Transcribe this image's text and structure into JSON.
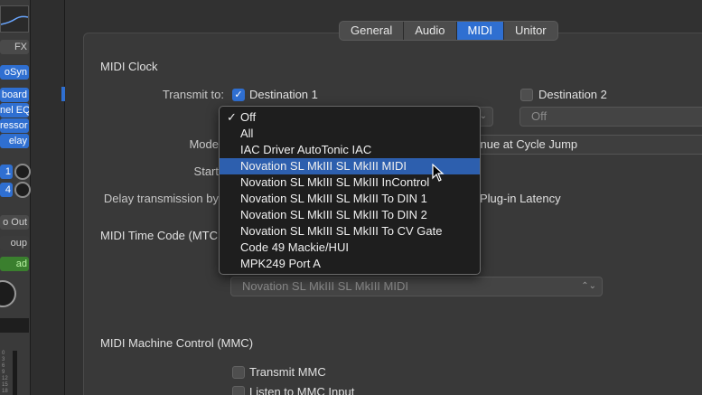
{
  "mixer": {
    "top_label": "FX",
    "plugins": [
      "oSyn",
      "board",
      "nel EQ",
      "ressor",
      "elay"
    ],
    "inputs": [
      "1",
      "4"
    ],
    "output": "o Out",
    "group": "oup",
    "automation": "ad",
    "scale": [
      "0",
      "3",
      "6",
      "9",
      "12",
      "15",
      "18",
      "21"
    ]
  },
  "tabs": [
    {
      "label": "General",
      "active": false
    },
    {
      "label": "Audio",
      "active": false
    },
    {
      "label": "MIDI",
      "active": true
    },
    {
      "label": "Unitor",
      "active": false
    }
  ],
  "midi_clock": {
    "title": "MIDI Clock",
    "transmit_label": "Transmit to:",
    "dest1_label": "Destination 1",
    "dest2_label": "Destination 2",
    "dest2_value": "Off",
    "mode_label": "Mode",
    "mode_value": "tinue at Cycle Jump",
    "start_label": "Start",
    "delay_label": "Delay transmission by",
    "plugin_latency_label": "Plug-in Latency"
  },
  "mtc": {
    "title": "MIDI Time Code (MTC",
    "destination_value": "Novation SL MkIII SL MkIII MIDI"
  },
  "mmc": {
    "title": "MIDI Machine Control (MMC)",
    "transmit_label": "Transmit MMC",
    "listen_label": "Listen to MMC Input"
  },
  "destination_menu": {
    "items": [
      {
        "label": "Off",
        "checked": true,
        "highlighted": false
      },
      {
        "label": "All",
        "checked": false,
        "highlighted": false
      },
      {
        "label": "IAC Driver AutoTonic IAC",
        "checked": false,
        "highlighted": false
      },
      {
        "label": "Novation SL MkIII SL MkIII MIDI",
        "checked": false,
        "highlighted": true
      },
      {
        "label": "Novation SL MkIII SL MkIII InControl",
        "checked": false,
        "highlighted": false
      },
      {
        "label": "Novation SL MkIII SL MkIII To DIN 1",
        "checked": false,
        "highlighted": false
      },
      {
        "label": "Novation SL MkIII SL MkIII To DIN 2",
        "checked": false,
        "highlighted": false
      },
      {
        "label": "Novation SL MkIII SL MkIII To CV Gate",
        "checked": false,
        "highlighted": false
      },
      {
        "label": "Code 49 Mackie/HUI",
        "checked": false,
        "highlighted": false
      },
      {
        "label": "MPK249 Port A",
        "checked": false,
        "highlighted": false
      }
    ]
  },
  "colors": {
    "accent": "#2f6fd1",
    "highlight": "#2d5fae"
  }
}
